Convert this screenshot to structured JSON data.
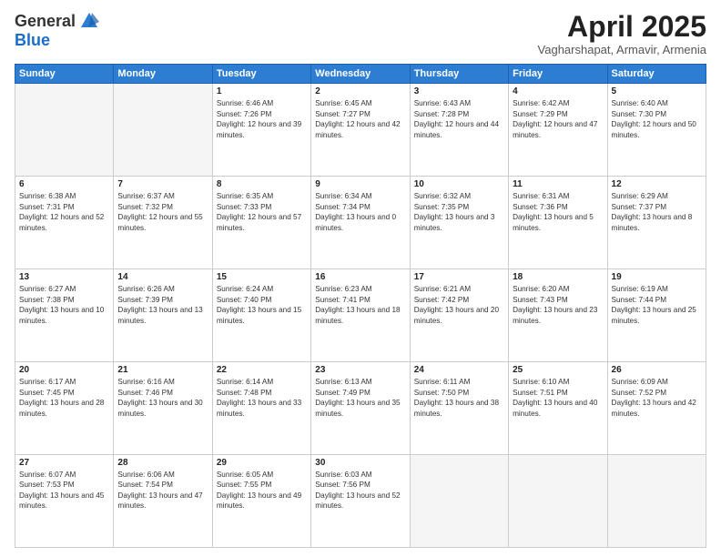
{
  "header": {
    "logo_general": "General",
    "logo_blue": "Blue",
    "month_title": "April 2025",
    "subtitle": "Vagharshapat, Armavir, Armenia"
  },
  "days_of_week": [
    "Sunday",
    "Monday",
    "Tuesday",
    "Wednesday",
    "Thursday",
    "Friday",
    "Saturday"
  ],
  "weeks": [
    [
      {
        "day": "",
        "info": ""
      },
      {
        "day": "",
        "info": ""
      },
      {
        "day": "1",
        "info": "Sunrise: 6:46 AM\nSunset: 7:26 PM\nDaylight: 12 hours and 39 minutes."
      },
      {
        "day": "2",
        "info": "Sunrise: 6:45 AM\nSunset: 7:27 PM\nDaylight: 12 hours and 42 minutes."
      },
      {
        "day": "3",
        "info": "Sunrise: 6:43 AM\nSunset: 7:28 PM\nDaylight: 12 hours and 44 minutes."
      },
      {
        "day": "4",
        "info": "Sunrise: 6:42 AM\nSunset: 7:29 PM\nDaylight: 12 hours and 47 minutes."
      },
      {
        "day": "5",
        "info": "Sunrise: 6:40 AM\nSunset: 7:30 PM\nDaylight: 12 hours and 50 minutes."
      }
    ],
    [
      {
        "day": "6",
        "info": "Sunrise: 6:38 AM\nSunset: 7:31 PM\nDaylight: 12 hours and 52 minutes."
      },
      {
        "day": "7",
        "info": "Sunrise: 6:37 AM\nSunset: 7:32 PM\nDaylight: 12 hours and 55 minutes."
      },
      {
        "day": "8",
        "info": "Sunrise: 6:35 AM\nSunset: 7:33 PM\nDaylight: 12 hours and 57 minutes."
      },
      {
        "day": "9",
        "info": "Sunrise: 6:34 AM\nSunset: 7:34 PM\nDaylight: 13 hours and 0 minutes."
      },
      {
        "day": "10",
        "info": "Sunrise: 6:32 AM\nSunset: 7:35 PM\nDaylight: 13 hours and 3 minutes."
      },
      {
        "day": "11",
        "info": "Sunrise: 6:31 AM\nSunset: 7:36 PM\nDaylight: 13 hours and 5 minutes."
      },
      {
        "day": "12",
        "info": "Sunrise: 6:29 AM\nSunset: 7:37 PM\nDaylight: 13 hours and 8 minutes."
      }
    ],
    [
      {
        "day": "13",
        "info": "Sunrise: 6:27 AM\nSunset: 7:38 PM\nDaylight: 13 hours and 10 minutes."
      },
      {
        "day": "14",
        "info": "Sunrise: 6:26 AM\nSunset: 7:39 PM\nDaylight: 13 hours and 13 minutes."
      },
      {
        "day": "15",
        "info": "Sunrise: 6:24 AM\nSunset: 7:40 PM\nDaylight: 13 hours and 15 minutes."
      },
      {
        "day": "16",
        "info": "Sunrise: 6:23 AM\nSunset: 7:41 PM\nDaylight: 13 hours and 18 minutes."
      },
      {
        "day": "17",
        "info": "Sunrise: 6:21 AM\nSunset: 7:42 PM\nDaylight: 13 hours and 20 minutes."
      },
      {
        "day": "18",
        "info": "Sunrise: 6:20 AM\nSunset: 7:43 PM\nDaylight: 13 hours and 23 minutes."
      },
      {
        "day": "19",
        "info": "Sunrise: 6:19 AM\nSunset: 7:44 PM\nDaylight: 13 hours and 25 minutes."
      }
    ],
    [
      {
        "day": "20",
        "info": "Sunrise: 6:17 AM\nSunset: 7:45 PM\nDaylight: 13 hours and 28 minutes."
      },
      {
        "day": "21",
        "info": "Sunrise: 6:16 AM\nSunset: 7:46 PM\nDaylight: 13 hours and 30 minutes."
      },
      {
        "day": "22",
        "info": "Sunrise: 6:14 AM\nSunset: 7:48 PM\nDaylight: 13 hours and 33 minutes."
      },
      {
        "day": "23",
        "info": "Sunrise: 6:13 AM\nSunset: 7:49 PM\nDaylight: 13 hours and 35 minutes."
      },
      {
        "day": "24",
        "info": "Sunrise: 6:11 AM\nSunset: 7:50 PM\nDaylight: 13 hours and 38 minutes."
      },
      {
        "day": "25",
        "info": "Sunrise: 6:10 AM\nSunset: 7:51 PM\nDaylight: 13 hours and 40 minutes."
      },
      {
        "day": "26",
        "info": "Sunrise: 6:09 AM\nSunset: 7:52 PM\nDaylight: 13 hours and 42 minutes."
      }
    ],
    [
      {
        "day": "27",
        "info": "Sunrise: 6:07 AM\nSunset: 7:53 PM\nDaylight: 13 hours and 45 minutes."
      },
      {
        "day": "28",
        "info": "Sunrise: 6:06 AM\nSunset: 7:54 PM\nDaylight: 13 hours and 47 minutes."
      },
      {
        "day": "29",
        "info": "Sunrise: 6:05 AM\nSunset: 7:55 PM\nDaylight: 13 hours and 49 minutes."
      },
      {
        "day": "30",
        "info": "Sunrise: 6:03 AM\nSunset: 7:56 PM\nDaylight: 13 hours and 52 minutes."
      },
      {
        "day": "",
        "info": ""
      },
      {
        "day": "",
        "info": ""
      },
      {
        "day": "",
        "info": ""
      }
    ]
  ]
}
